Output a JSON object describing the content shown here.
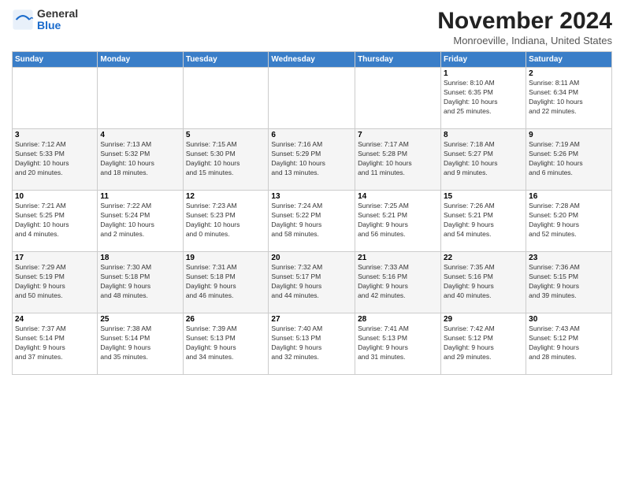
{
  "logo": {
    "general": "General",
    "blue": "Blue"
  },
  "header": {
    "month": "November 2024",
    "location": "Monroeville, Indiana, United States"
  },
  "weekdays": [
    "Sunday",
    "Monday",
    "Tuesday",
    "Wednesday",
    "Thursday",
    "Friday",
    "Saturday"
  ],
  "weeks": [
    [
      {
        "day": "",
        "info": ""
      },
      {
        "day": "",
        "info": ""
      },
      {
        "day": "",
        "info": ""
      },
      {
        "day": "",
        "info": ""
      },
      {
        "day": "",
        "info": ""
      },
      {
        "day": "1",
        "info": "Sunrise: 8:10 AM\nSunset: 6:35 PM\nDaylight: 10 hours\nand 25 minutes."
      },
      {
        "day": "2",
        "info": "Sunrise: 8:11 AM\nSunset: 6:34 PM\nDaylight: 10 hours\nand 22 minutes."
      }
    ],
    [
      {
        "day": "3",
        "info": "Sunrise: 7:12 AM\nSunset: 5:33 PM\nDaylight: 10 hours\nand 20 minutes."
      },
      {
        "day": "4",
        "info": "Sunrise: 7:13 AM\nSunset: 5:32 PM\nDaylight: 10 hours\nand 18 minutes."
      },
      {
        "day": "5",
        "info": "Sunrise: 7:15 AM\nSunset: 5:30 PM\nDaylight: 10 hours\nand 15 minutes."
      },
      {
        "day": "6",
        "info": "Sunrise: 7:16 AM\nSunset: 5:29 PM\nDaylight: 10 hours\nand 13 minutes."
      },
      {
        "day": "7",
        "info": "Sunrise: 7:17 AM\nSunset: 5:28 PM\nDaylight: 10 hours\nand 11 minutes."
      },
      {
        "day": "8",
        "info": "Sunrise: 7:18 AM\nSunset: 5:27 PM\nDaylight: 10 hours\nand 9 minutes."
      },
      {
        "day": "9",
        "info": "Sunrise: 7:19 AM\nSunset: 5:26 PM\nDaylight: 10 hours\nand 6 minutes."
      }
    ],
    [
      {
        "day": "10",
        "info": "Sunrise: 7:21 AM\nSunset: 5:25 PM\nDaylight: 10 hours\nand 4 minutes."
      },
      {
        "day": "11",
        "info": "Sunrise: 7:22 AM\nSunset: 5:24 PM\nDaylight: 10 hours\nand 2 minutes."
      },
      {
        "day": "12",
        "info": "Sunrise: 7:23 AM\nSunset: 5:23 PM\nDaylight: 10 hours\nand 0 minutes."
      },
      {
        "day": "13",
        "info": "Sunrise: 7:24 AM\nSunset: 5:22 PM\nDaylight: 9 hours\nand 58 minutes."
      },
      {
        "day": "14",
        "info": "Sunrise: 7:25 AM\nSunset: 5:21 PM\nDaylight: 9 hours\nand 56 minutes."
      },
      {
        "day": "15",
        "info": "Sunrise: 7:26 AM\nSunset: 5:21 PM\nDaylight: 9 hours\nand 54 minutes."
      },
      {
        "day": "16",
        "info": "Sunrise: 7:28 AM\nSunset: 5:20 PM\nDaylight: 9 hours\nand 52 minutes."
      }
    ],
    [
      {
        "day": "17",
        "info": "Sunrise: 7:29 AM\nSunset: 5:19 PM\nDaylight: 9 hours\nand 50 minutes."
      },
      {
        "day": "18",
        "info": "Sunrise: 7:30 AM\nSunset: 5:18 PM\nDaylight: 9 hours\nand 48 minutes."
      },
      {
        "day": "19",
        "info": "Sunrise: 7:31 AM\nSunset: 5:18 PM\nDaylight: 9 hours\nand 46 minutes."
      },
      {
        "day": "20",
        "info": "Sunrise: 7:32 AM\nSunset: 5:17 PM\nDaylight: 9 hours\nand 44 minutes."
      },
      {
        "day": "21",
        "info": "Sunrise: 7:33 AM\nSunset: 5:16 PM\nDaylight: 9 hours\nand 42 minutes."
      },
      {
        "day": "22",
        "info": "Sunrise: 7:35 AM\nSunset: 5:16 PM\nDaylight: 9 hours\nand 40 minutes."
      },
      {
        "day": "23",
        "info": "Sunrise: 7:36 AM\nSunset: 5:15 PM\nDaylight: 9 hours\nand 39 minutes."
      }
    ],
    [
      {
        "day": "24",
        "info": "Sunrise: 7:37 AM\nSunset: 5:14 PM\nDaylight: 9 hours\nand 37 minutes."
      },
      {
        "day": "25",
        "info": "Sunrise: 7:38 AM\nSunset: 5:14 PM\nDaylight: 9 hours\nand 35 minutes."
      },
      {
        "day": "26",
        "info": "Sunrise: 7:39 AM\nSunset: 5:13 PM\nDaylight: 9 hours\nand 34 minutes."
      },
      {
        "day": "27",
        "info": "Sunrise: 7:40 AM\nSunset: 5:13 PM\nDaylight: 9 hours\nand 32 minutes."
      },
      {
        "day": "28",
        "info": "Sunrise: 7:41 AM\nSunset: 5:13 PM\nDaylight: 9 hours\nand 31 minutes."
      },
      {
        "day": "29",
        "info": "Sunrise: 7:42 AM\nSunset: 5:12 PM\nDaylight: 9 hours\nand 29 minutes."
      },
      {
        "day": "30",
        "info": "Sunrise: 7:43 AM\nSunset: 5:12 PM\nDaylight: 9 hours\nand 28 minutes."
      }
    ]
  ]
}
